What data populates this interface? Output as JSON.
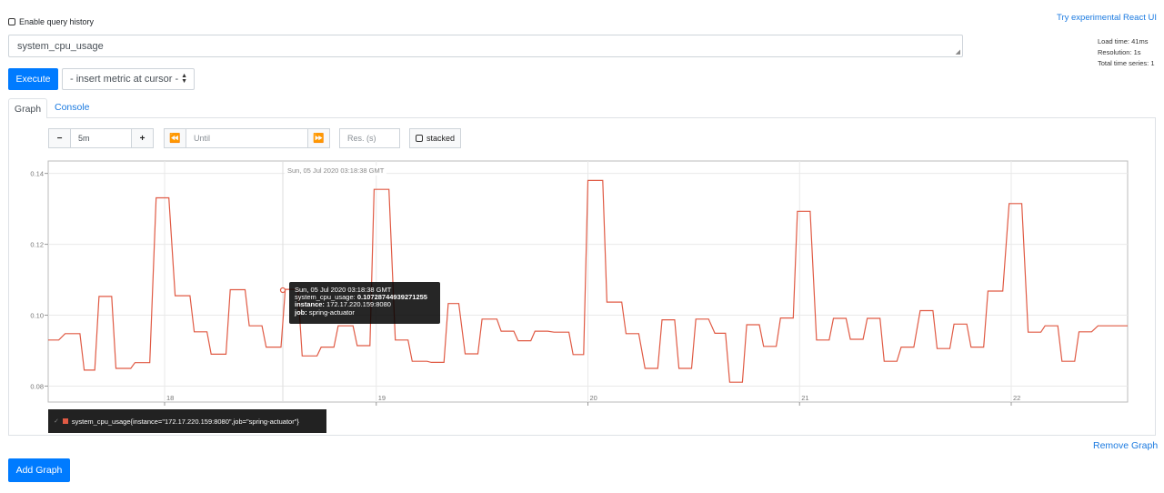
{
  "header": {
    "enable_history_label": "Enable query history",
    "react_link": "Try experimental React UI",
    "load_time": "Load time: 41ms",
    "resolution": "Resolution: 1s",
    "total_series": "Total time series: 1"
  },
  "query": {
    "value": "system_cpu_usage",
    "execute_label": "Execute",
    "metric_select_label": "- insert metric at cursor -"
  },
  "tabs": {
    "graph": "Graph",
    "console": "Console"
  },
  "controls": {
    "minus": "−",
    "range": "5m",
    "plus": "+",
    "back": "⏪",
    "until_placeholder": "Until",
    "forward": "⏩",
    "res_placeholder": "Res. (s)",
    "stacked_label": "stacked"
  },
  "hover": {
    "time_label": "Sun, 05 Jul 2020 03:18:38 GMT",
    "tooltip_time": "Sun, 05 Jul 2020 03:18:38 GMT",
    "tooltip_metric_key": "system_cpu_usage:",
    "tooltip_metric_value": "0.10728744939271255",
    "tooltip_instance_key": "instance:",
    "tooltip_instance_value": "172.17.220.159:8080",
    "tooltip_job_key": "job:",
    "tooltip_job_value": "spring-actuator"
  },
  "legend": {
    "series": "system_cpu_usage{instance=\"172.17.220.159:8080\",job=\"spring-actuator\"}"
  },
  "footer": {
    "remove_graph": "Remove Graph",
    "add_graph": "Add Graph"
  },
  "colors": {
    "line": "#e05a44",
    "accent": "#007bff"
  },
  "chart_data": {
    "type": "line",
    "xlabel": "",
    "ylabel": "",
    "x_ticks": [
      "18",
      "19",
      "20",
      "21",
      "22"
    ],
    "y_ticks": [
      0.08,
      0.1,
      0.12,
      0.14
    ],
    "ylim": [
      0.0755,
      0.1435
    ],
    "xlim": [
      17.45,
      22.55
    ],
    "grid": true,
    "series": [
      {
        "values": [
          [
            17.45,
            0.093
          ],
          [
            17.5,
            0.093
          ],
          [
            17.53,
            0.0948
          ],
          [
            17.6,
            0.0948
          ],
          [
            17.62,
            0.0845
          ],
          [
            17.67,
            0.0845
          ],
          [
            17.69,
            0.1053
          ],
          [
            17.75,
            0.1053
          ],
          [
            17.77,
            0.085
          ],
          [
            17.84,
            0.085
          ],
          [
            17.86,
            0.0866
          ],
          [
            17.93,
            0.0866
          ],
          [
            17.96,
            0.1331
          ],
          [
            18.02,
            0.1331
          ],
          [
            18.05,
            0.1055
          ],
          [
            18.12,
            0.1055
          ],
          [
            18.14,
            0.0953
          ],
          [
            18.2,
            0.0953
          ],
          [
            18.22,
            0.089
          ],
          [
            18.29,
            0.089
          ],
          [
            18.31,
            0.1072
          ],
          [
            18.38,
            0.1072
          ],
          [
            18.4,
            0.097
          ],
          [
            18.46,
            0.097
          ],
          [
            18.48,
            0.091
          ],
          [
            18.55,
            0.091
          ],
          [
            18.57,
            0.1073
          ],
          [
            18.63,
            0.1073
          ],
          [
            18.65,
            0.0885
          ],
          [
            18.72,
            0.0885
          ],
          [
            18.74,
            0.091
          ],
          [
            18.8,
            0.091
          ],
          [
            18.82,
            0.097
          ],
          [
            18.89,
            0.097
          ],
          [
            18.91,
            0.0914
          ],
          [
            18.97,
            0.0914
          ],
          [
            18.99,
            0.1355
          ],
          [
            19.06,
            0.1355
          ],
          [
            19.09,
            0.093
          ],
          [
            19.15,
            0.093
          ],
          [
            19.17,
            0.087
          ],
          [
            19.24,
            0.087
          ],
          [
            19.26,
            0.0867
          ],
          [
            19.32,
            0.0867
          ],
          [
            19.34,
            0.1033
          ],
          [
            19.39,
            0.1033
          ],
          [
            19.42,
            0.0891
          ],
          [
            19.48,
            0.0891
          ],
          [
            19.5,
            0.0989
          ],
          [
            19.57,
            0.0989
          ],
          [
            19.59,
            0.0955
          ],
          [
            19.65,
            0.0955
          ],
          [
            19.67,
            0.0928
          ],
          [
            19.73,
            0.0928
          ],
          [
            19.75,
            0.0955
          ],
          [
            19.81,
            0.0955
          ],
          [
            19.84,
            0.0952
          ],
          [
            19.91,
            0.0952
          ],
          [
            19.93,
            0.0889
          ],
          [
            19.98,
            0.0889
          ],
          [
            20.0,
            0.138
          ],
          [
            20.07,
            0.138
          ],
          [
            20.09,
            0.1037
          ],
          [
            20.16,
            0.1037
          ],
          [
            20.18,
            0.0948
          ],
          [
            20.24,
            0.0948
          ],
          [
            20.27,
            0.085
          ],
          [
            20.33,
            0.085
          ],
          [
            20.35,
            0.0987
          ],
          [
            20.41,
            0.0987
          ],
          [
            20.43,
            0.085
          ],
          [
            20.49,
            0.085
          ],
          [
            20.51,
            0.0989
          ],
          [
            20.57,
            0.0989
          ],
          [
            20.6,
            0.0949
          ],
          [
            20.65,
            0.0949
          ],
          [
            20.67,
            0.0811
          ],
          [
            20.73,
            0.0811
          ],
          [
            20.75,
            0.0973
          ],
          [
            20.81,
            0.0973
          ],
          [
            20.83,
            0.0912
          ],
          [
            20.89,
            0.0912
          ],
          [
            20.91,
            0.0992
          ],
          [
            20.97,
            0.0992
          ],
          [
            20.99,
            0.1293
          ],
          [
            21.05,
            0.1293
          ],
          [
            21.08,
            0.093
          ],
          [
            21.14,
            0.093
          ],
          [
            21.16,
            0.0991
          ],
          [
            21.22,
            0.0991
          ],
          [
            21.24,
            0.0932
          ],
          [
            21.3,
            0.0932
          ],
          [
            21.32,
            0.0991
          ],
          [
            21.38,
            0.0991
          ],
          [
            21.4,
            0.087
          ],
          [
            21.46,
            0.087
          ],
          [
            21.48,
            0.091
          ],
          [
            21.54,
            0.091
          ],
          [
            21.57,
            0.1013
          ],
          [
            21.63,
            0.1013
          ],
          [
            21.65,
            0.0906
          ],
          [
            21.71,
            0.0906
          ],
          [
            21.73,
            0.0975
          ],
          [
            21.79,
            0.0975
          ],
          [
            21.81,
            0.091
          ],
          [
            21.87,
            0.091
          ],
          [
            21.89,
            0.1068
          ],
          [
            21.96,
            0.1068
          ],
          [
            21.99,
            0.1315
          ],
          [
            22.05,
            0.1315
          ],
          [
            22.08,
            0.0952
          ],
          [
            22.14,
            0.0952
          ],
          [
            22.16,
            0.097
          ],
          [
            22.22,
            0.097
          ],
          [
            22.24,
            0.087
          ],
          [
            22.3,
            0.087
          ],
          [
            22.32,
            0.0953
          ],
          [
            22.38,
            0.0953
          ],
          [
            22.41,
            0.097
          ],
          [
            22.55,
            0.097
          ]
        ]
      }
    ]
  }
}
